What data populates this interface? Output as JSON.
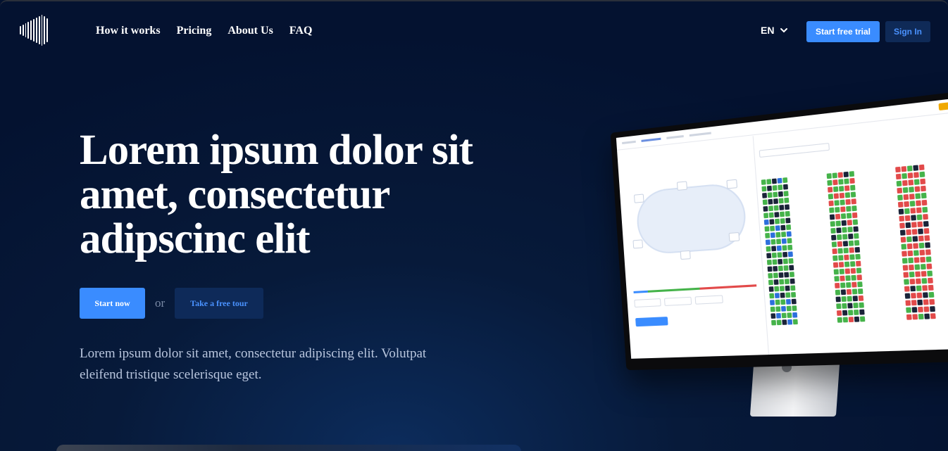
{
  "nav": {
    "links": [
      "How it works",
      "Pricing",
      "About Us",
      "FAQ"
    ],
    "language": "EN",
    "start_trial_label": "Start free trial",
    "sign_in_label": "Sign In"
  },
  "hero": {
    "title": "Lorem ipsum dolor sit amet, consectetur adipscinc elit",
    "start_label": "Start now",
    "or_text": "or",
    "tour_label": "Take a free tour",
    "subtitle": "Lorem ipsum dolor sit amet, consectetur adipiscing elit. Volutpat eleifend tristique scelerisque eget."
  },
  "colors": {
    "background": "#041230",
    "accent": "#3a8cff",
    "secondary_button": "#0e2a59"
  },
  "icons": {
    "logo": "striped-waveform-logo",
    "language_chevron": "chevron-down-icon"
  }
}
